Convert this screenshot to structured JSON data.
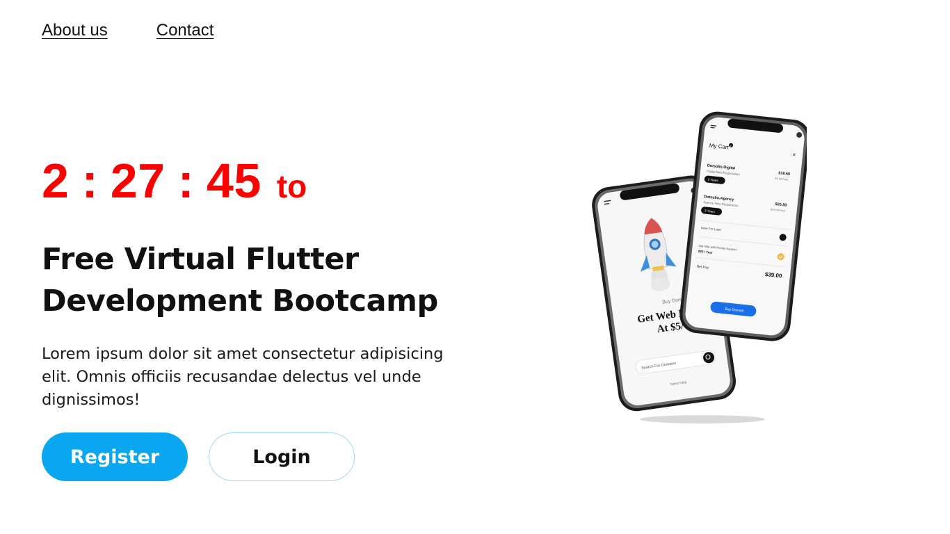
{
  "nav": {
    "about_label": "About us",
    "contact_label": "Contact"
  },
  "countdown": {
    "hours": "2",
    "minutes": "27",
    "seconds": "45",
    "separator": ":",
    "suffix": "to",
    "color": "#ff0000"
  },
  "hero": {
    "title": "Free Virtual Flutter Development Bootcamp",
    "description": "Lorem ipsum dolor sit amet consectetur adipisicing elit. Omnis officiis recusandae delectus vel unde dignissimos!"
  },
  "buttons": {
    "register_label": "Register",
    "login_label": "Login",
    "accent_color": "#0aa6f0"
  },
  "phone_back": {
    "buy_domain": "Buy Domain",
    "headline_line1": "Get Web Do",
    "headline_line2": "At $5/",
    "search_placeholder": "Search For Domains",
    "need_help": "Need Help"
  },
  "phone_front": {
    "cart_title": "My Cart",
    "cart_count": "2",
    "items": [
      {
        "name": "Dotsolio.Digital",
        "sub": "Digital New Registration",
        "price": "$18.50",
        "price_sub": "$4.00/Year",
        "term": "2 Years"
      },
      {
        "name": "Dotsolio.Agency",
        "sub": "Agency New Registration",
        "price": "$20.50",
        "price_sub": "$10.00/Year",
        "term": "3 Years"
      }
    ],
    "save_later": "Save For Later",
    "support_text": "Get help with Priority Support",
    "support_price": "$25 / Year",
    "net_pay_label": "Net Pay",
    "net_pay_value": "$39.00",
    "cta": "Buy Domain"
  }
}
